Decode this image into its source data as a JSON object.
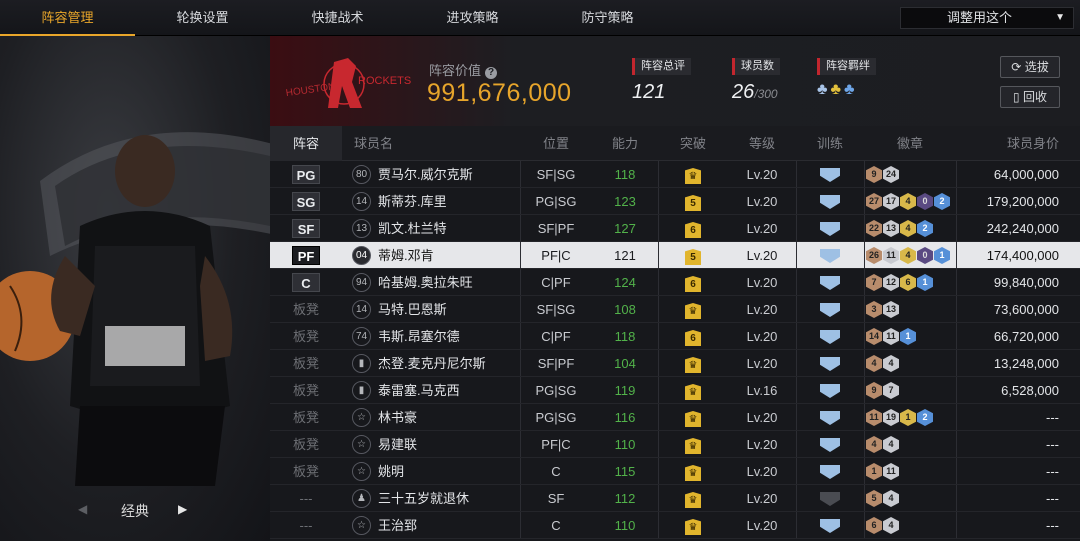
{
  "tabs": [
    "阵容管理",
    "轮换设置",
    "快捷战术",
    "进攻策略",
    "防守策略"
  ],
  "active_tab": 0,
  "apply_select": {
    "value": "调整用这个"
  },
  "left_panel": {
    "style_label": "经典"
  },
  "header": {
    "value_label": "阵容价值",
    "value": "991,676,000",
    "rating_label": "阵容总评",
    "rating": "121",
    "count_label": "球员数",
    "count": "26",
    "count_max": "/300",
    "bond_label": "阵容羁绊",
    "select_button": "选拔",
    "recycle_button": "回收"
  },
  "columns": [
    "阵容",
    "球员名",
    "位置",
    "能力",
    "突破",
    "等级",
    "训练",
    "徽章",
    "球员身价"
  ],
  "rows": [
    {
      "pos": "PG",
      "num": "80",
      "name": "贾马尔.威尔克斯",
      "position": "SF|SG",
      "ability": "118",
      "breakthrough": "",
      "level": "Lv.20",
      "badges": [
        [
          "9",
          "b-bronze"
        ],
        [
          "24",
          "b-silver"
        ]
      ],
      "price": "64,000,000"
    },
    {
      "pos": "SG",
      "num": "14",
      "name": "斯蒂芬.库里",
      "position": "PG|SG",
      "ability": "123",
      "breakthrough": "5",
      "level": "Lv.20",
      "badges": [
        [
          "27",
          "b-bronze"
        ],
        [
          "17",
          "b-silver"
        ],
        [
          "4",
          "b-gold"
        ],
        [
          "0",
          "b-purple"
        ],
        [
          "2",
          "b-blue"
        ]
      ],
      "price": "179,200,000"
    },
    {
      "pos": "SF",
      "num": "13",
      "name": "凯文.杜兰特",
      "position": "SF|PF",
      "ability": "127",
      "breakthrough": "6",
      "level": "Lv.20",
      "badges": [
        [
          "22",
          "b-bronze"
        ],
        [
          "13",
          "b-silver"
        ],
        [
          "4",
          "b-gold"
        ],
        [
          "2",
          "b-blue"
        ]
      ],
      "price": "242,240,000"
    },
    {
      "pos": "PF",
      "num": "04",
      "name": "蒂姆.邓肯",
      "position": "PF|C",
      "ability": "121",
      "breakthrough": "5",
      "level": "Lv.20",
      "badges": [
        [
          "26",
          "b-bronze"
        ],
        [
          "11",
          "b-silver"
        ],
        [
          "4",
          "b-gold"
        ],
        [
          "0",
          "b-purple"
        ],
        [
          "1",
          "b-blue"
        ]
      ],
      "price": "174,400,000",
      "selected": true
    },
    {
      "pos": "C",
      "num": "94",
      "name": "哈基姆.奥拉朱旺",
      "position": "C|PF",
      "ability": "124",
      "breakthrough": "6",
      "level": "Lv.20",
      "badges": [
        [
          "7",
          "b-bronze"
        ],
        [
          "12",
          "b-silver"
        ],
        [
          "6",
          "b-gold"
        ],
        [
          "1",
          "b-blue"
        ]
      ],
      "price": "99,840,000"
    },
    {
      "pos": "板凳",
      "num": "14",
      "name": "马特.巴恩斯",
      "position": "SF|SG",
      "ability": "108",
      "breakthrough": "",
      "level": "Lv.20",
      "badges": [
        [
          "3",
          "b-bronze"
        ],
        [
          "13",
          "b-silver"
        ]
      ],
      "price": "73,600,000"
    },
    {
      "pos": "板凳",
      "num": "74",
      "name": "韦斯.昂塞尔德",
      "position": "C|PF",
      "ability": "118",
      "breakthrough": "6",
      "level": "Lv.20",
      "badges": [
        [
          "14",
          "b-bronze"
        ],
        [
          "11",
          "b-silver"
        ],
        [
          "1",
          "b-blue"
        ]
      ],
      "price": "66,720,000"
    },
    {
      "pos": "板凳",
      "num": "",
      "name": "杰登.麦克丹尼尔斯",
      "position": "SF|PF",
      "ability": "104",
      "breakthrough": "",
      "level": "Lv.20",
      "badges": [
        [
          "4",
          "b-bronze"
        ],
        [
          "4",
          "b-silver"
        ]
      ],
      "price": "13,248,000"
    },
    {
      "pos": "板凳",
      "num": "",
      "name": "泰雷塞.马克西",
      "position": "PG|SG",
      "ability": "119",
      "breakthrough": "",
      "level": "Lv.16",
      "badges": [
        [
          "9",
          "b-bronze"
        ],
        [
          "7",
          "b-silver"
        ]
      ],
      "price": "6,528,000"
    },
    {
      "pos": "板凳",
      "num": "",
      "name": "林书豪",
      "position": "PG|SG",
      "ability": "116",
      "breakthrough": "",
      "level": "Lv.20",
      "badges": [
        [
          "11",
          "b-bronze"
        ],
        [
          "19",
          "b-silver"
        ],
        [
          "1",
          "b-gold"
        ],
        [
          "2",
          "b-blue"
        ]
      ],
      "price": "---"
    },
    {
      "pos": "板凳",
      "num": "",
      "name": "易建联",
      "position": "PF|C",
      "ability": "110",
      "breakthrough": "",
      "level": "Lv.20",
      "badges": [
        [
          "4",
          "b-bronze"
        ],
        [
          "4",
          "b-silver"
        ]
      ],
      "price": "---"
    },
    {
      "pos": "板凳",
      "num": "",
      "name": "姚明",
      "position": "C",
      "ability": "115",
      "breakthrough": "",
      "level": "Lv.20",
      "badges": [
        [
          "1",
          "b-bronze"
        ],
        [
          "11",
          "b-silver"
        ]
      ],
      "price": "---"
    },
    {
      "pos": "---",
      "num": "",
      "name": "三十五岁就退休",
      "position": "SF",
      "ability": "112",
      "breakthrough": "",
      "level": "Lv.20",
      "badges": [
        [
          "5",
          "b-bronze"
        ],
        [
          "4",
          "b-silver"
        ]
      ],
      "price": "---",
      "train_grey": true
    },
    {
      "pos": "---",
      "num": "",
      "name": "王治郅",
      "position": "C",
      "ability": "110",
      "breakthrough": "",
      "level": "Lv.20",
      "badges": [
        [
          "6",
          "b-bronze"
        ],
        [
          "4",
          "b-silver"
        ]
      ],
      "price": "---"
    }
  ]
}
